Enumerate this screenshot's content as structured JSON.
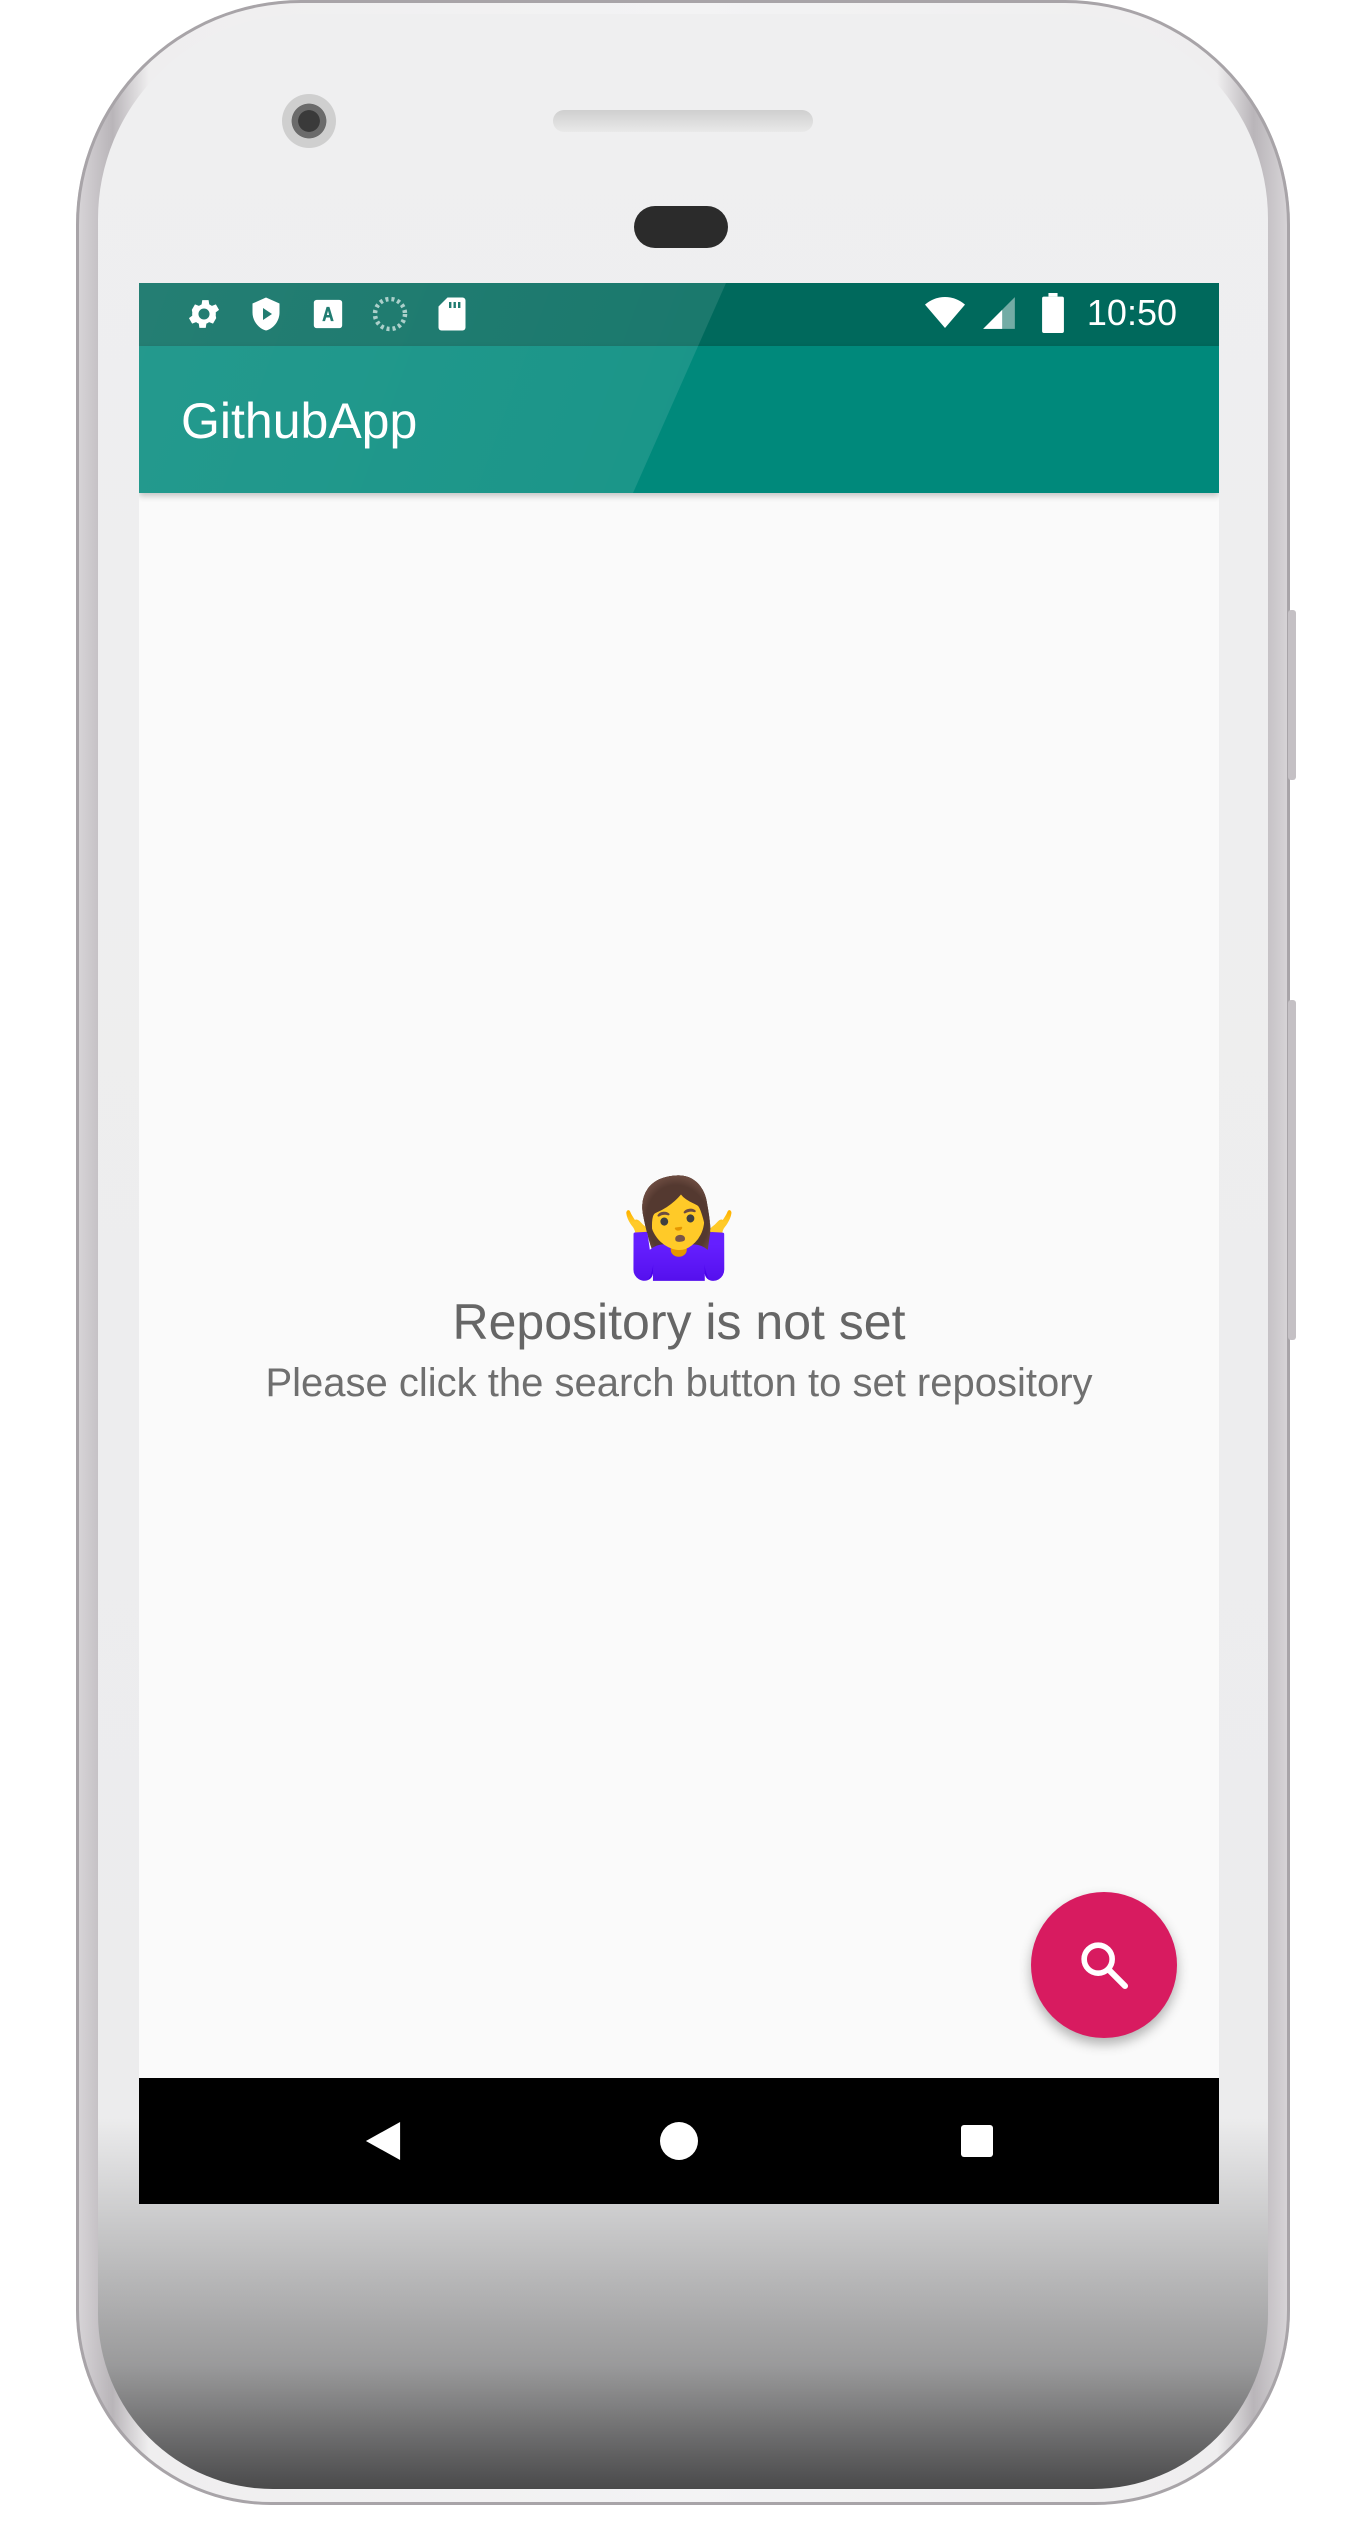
{
  "app": {
    "title": "GithubApp"
  },
  "status_bar": {
    "time": "10:50",
    "left_icons": [
      "settings-icon",
      "shield-play-icon",
      "text-a-icon",
      "progress-circle-icon",
      "sd-card-icon"
    ],
    "right_icons": [
      "wifi-icon",
      "signal-icon",
      "battery-icon"
    ]
  },
  "empty_state": {
    "emoji": "🤷‍♀️",
    "title": "Repository is not set",
    "subtitle": "Please click the search button to set repository"
  },
  "fab": {
    "icon": "search-icon"
  },
  "nav_bar": {
    "buttons": [
      "back-icon",
      "home-icon",
      "recents-icon"
    ]
  },
  "colors": {
    "status_bar": "#00695c",
    "app_bar": "#00897b",
    "fab": "#d81b60",
    "background": "#fafafa"
  }
}
